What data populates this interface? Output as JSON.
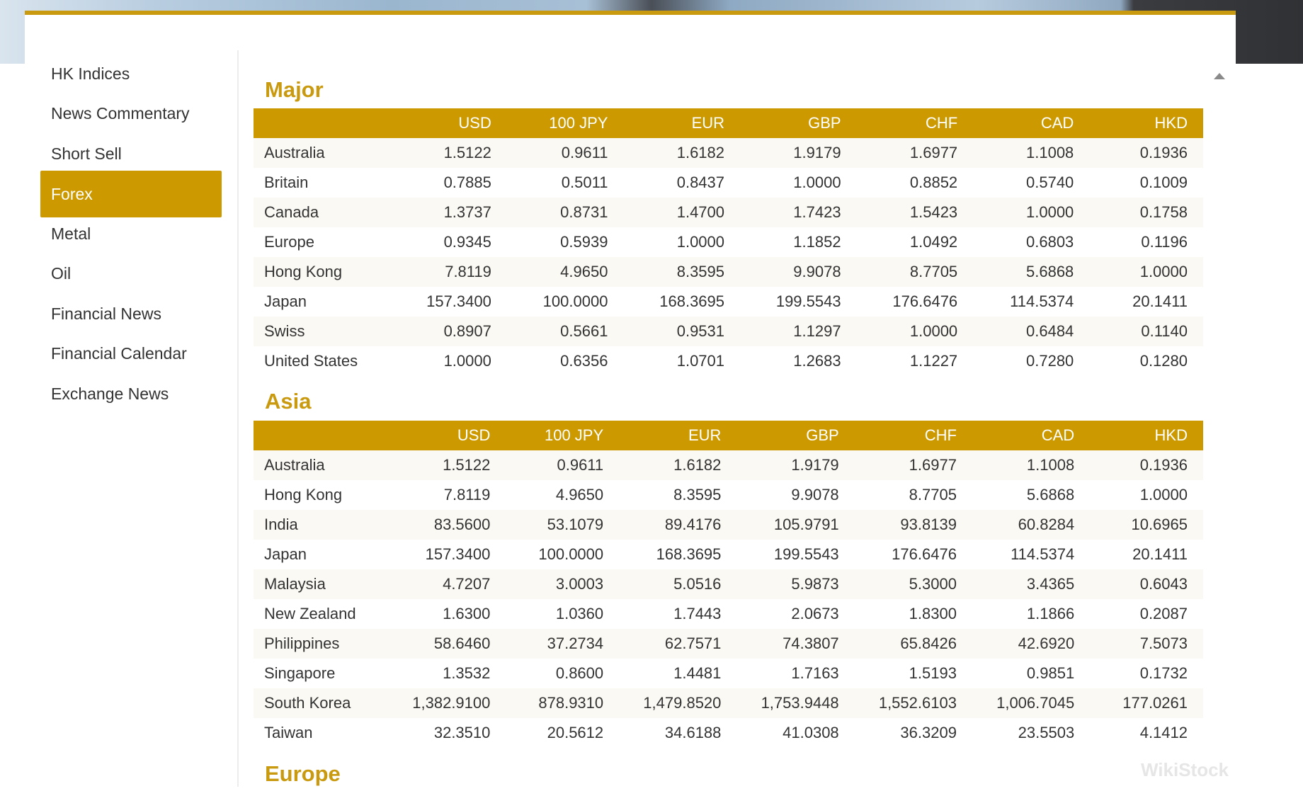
{
  "sidebar": {
    "items": [
      {
        "label": "HK Indices",
        "active": false
      },
      {
        "label": "News Commentary",
        "active": false
      },
      {
        "label": "Short Sell",
        "active": false
      },
      {
        "label": "Forex",
        "active": true
      },
      {
        "label": "Metal",
        "active": false
      },
      {
        "label": "Oil",
        "active": false
      },
      {
        "label": "Financial News",
        "active": false
      },
      {
        "label": "Financial Calendar",
        "active": false
      },
      {
        "label": "Exchange News",
        "active": false
      }
    ]
  },
  "columns": [
    "",
    "USD",
    "100 JPY",
    "EUR",
    "GBP",
    "CHF",
    "CAD",
    "HKD"
  ],
  "sections": [
    {
      "title": "Major",
      "rows": [
        [
          "Australia",
          "1.5122",
          "0.9611",
          "1.6182",
          "1.9179",
          "1.6977",
          "1.1008",
          "0.1936"
        ],
        [
          "Britain",
          "0.7885",
          "0.5011",
          "0.8437",
          "1.0000",
          "0.8852",
          "0.5740",
          "0.1009"
        ],
        [
          "Canada",
          "1.3737",
          "0.8731",
          "1.4700",
          "1.7423",
          "1.5423",
          "1.0000",
          "0.1758"
        ],
        [
          "Europe",
          "0.9345",
          "0.5939",
          "1.0000",
          "1.1852",
          "1.0492",
          "0.6803",
          "0.1196"
        ],
        [
          "Hong Kong",
          "7.8119",
          "4.9650",
          "8.3595",
          "9.9078",
          "8.7705",
          "5.6868",
          "1.0000"
        ],
        [
          "Japan",
          "157.3400",
          "100.0000",
          "168.3695",
          "199.5543",
          "176.6476",
          "114.5374",
          "20.1411"
        ],
        [
          "Swiss",
          "0.8907",
          "0.5661",
          "0.9531",
          "1.1297",
          "1.0000",
          "0.6484",
          "0.1140"
        ],
        [
          "United States",
          "1.0000",
          "0.6356",
          "1.0701",
          "1.2683",
          "1.1227",
          "0.7280",
          "0.1280"
        ]
      ]
    },
    {
      "title": "Asia",
      "rows": [
        [
          "Australia",
          "1.5122",
          "0.9611",
          "1.6182",
          "1.9179",
          "1.6977",
          "1.1008",
          "0.1936"
        ],
        [
          "Hong Kong",
          "7.8119",
          "4.9650",
          "8.3595",
          "9.9078",
          "8.7705",
          "5.6868",
          "1.0000"
        ],
        [
          "India",
          "83.5600",
          "53.1079",
          "89.4176",
          "105.9791",
          "93.8139",
          "60.8284",
          "10.6965"
        ],
        [
          "Japan",
          "157.3400",
          "100.0000",
          "168.3695",
          "199.5543",
          "176.6476",
          "114.5374",
          "20.1411"
        ],
        [
          "Malaysia",
          "4.7207",
          "3.0003",
          "5.0516",
          "5.9873",
          "5.3000",
          "3.4365",
          "0.6043"
        ],
        [
          "New Zealand",
          "1.6300",
          "1.0360",
          "1.7443",
          "2.0673",
          "1.8300",
          "1.1866",
          "0.2087"
        ],
        [
          "Philippines",
          "58.6460",
          "37.2734",
          "62.7571",
          "74.3807",
          "65.8426",
          "42.6920",
          "7.5073"
        ],
        [
          "Singapore",
          "1.3532",
          "0.8600",
          "1.4481",
          "1.7163",
          "1.5193",
          "0.9851",
          "0.1732"
        ],
        [
          "South Korea",
          "1,382.9100",
          "878.9310",
          "1,479.8520",
          "1,753.9448",
          "1,552.6103",
          "1,006.7045",
          "177.0261"
        ],
        [
          "Taiwan",
          "32.3510",
          "20.5612",
          "34.6188",
          "41.0308",
          "36.3209",
          "23.5503",
          "4.1412"
        ]
      ]
    },
    {
      "title": "Europe",
      "rows": []
    }
  ],
  "watermark": "WikiStock"
}
